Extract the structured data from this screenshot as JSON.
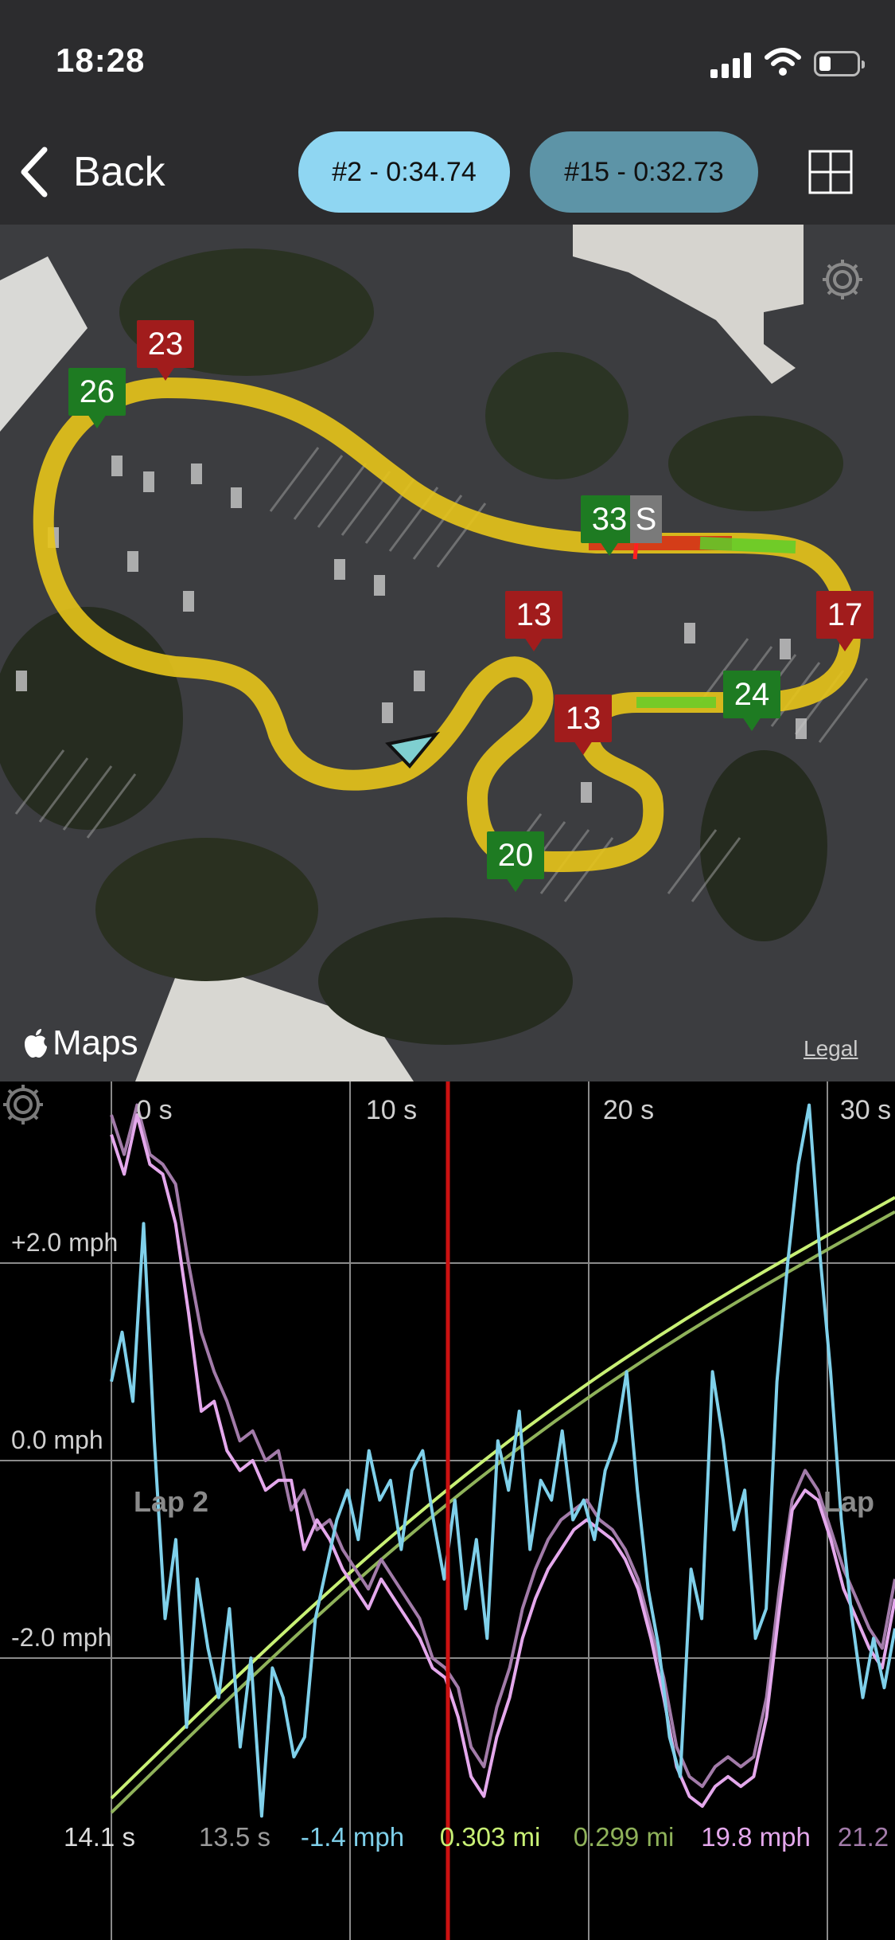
{
  "status_bar": {
    "time": "18:28"
  },
  "nav": {
    "back_label": "Back",
    "lap_a_label": "#2 - 0:34.74",
    "lap_b_label": "#15 - 0:32.73",
    "grid_icon": "grid-icon"
  },
  "map": {
    "attribution": "Maps",
    "legal": "Legal",
    "start_label": "S",
    "markers": [
      {
        "text": "23",
        "color": "red"
      },
      {
        "text": "26",
        "color": "green"
      },
      {
        "text": "33",
        "color": "green"
      },
      {
        "text": "13",
        "color": "red"
      },
      {
        "text": "17",
        "color": "red"
      },
      {
        "text": "24",
        "color": "green"
      },
      {
        "text": "13",
        "color": "red"
      },
      {
        "text": "20",
        "color": "green"
      }
    ]
  },
  "chart_data": {
    "type": "line",
    "x_ticks": [
      "0 s",
      "10 s",
      "20 s",
      "30 s"
    ],
    "y_ticks": [
      "+2.0 mph",
      "0.0 mph",
      "-2.0 mph"
    ],
    "lap_labels": [
      "Lap 2",
      "Lap"
    ],
    "cursor_time_s": 14.1,
    "colors": {
      "delta_speed": "#7fd0ea",
      "speed_a": "#e4a8ec",
      "speed_b": "#a27ba9",
      "distance_a": "#c8f075",
      "distance_b": "#8fb25a",
      "cursor": "#cc1111"
    },
    "readouts": [
      {
        "text": "14.1 s",
        "color": "#dddddd"
      },
      {
        "text": "13.5 s",
        "color": "#9a9a9a"
      },
      {
        "text": "-1.4 mph",
        "color": "#7fd0ea"
      },
      {
        "text": "0.303 mi",
        "color": "#c8f075"
      },
      {
        "text": "0.299 mi",
        "color": "#8fb25a"
      },
      {
        "text": "19.8 mph",
        "color": "#e4a8ec"
      },
      {
        "text": "21.2",
        "color": "#a27ba9"
      }
    ],
    "delta_speed_mph": [
      0.8,
      1.3,
      0.6,
      2.4,
      0.2,
      -1.6,
      -0.8,
      -2.7,
      -1.2,
      -1.9,
      -2.4,
      -1.5,
      -2.9,
      -2.0,
      -3.6,
      -2.1,
      -2.4,
      -3.0,
      -2.8,
      -1.6,
      -1.1,
      -0.6,
      -0.3,
      -0.8,
      0.1,
      -0.4,
      -0.2,
      -0.9,
      -0.1,
      0.1,
      -0.6,
      -1.2,
      -0.4,
      -1.5,
      -0.8,
      -1.8,
      0.2,
      -0.3,
      0.5,
      -0.9,
      -0.2,
      -0.4,
      0.3,
      -0.6,
      -0.4,
      -0.8,
      -0.1,
      0.2,
      0.9,
      -0.3,
      -1.3,
      -1.9,
      -2.8,
      -3.2,
      -1.1,
      -1.6,
      0.9,
      0.2,
      -0.7,
      -0.3,
      -1.8,
      -1.5,
      0.8,
      2.0,
      3.0,
      3.6,
      2.1,
      0.9,
      -0.6,
      -1.6,
      -2.4,
      -1.8,
      -2.3,
      -1.7
    ],
    "speed_a_mph": [
      3.3,
      2.9,
      3.5,
      3.0,
      2.9,
      2.4,
      1.5,
      0.5,
      0.6,
      0.1,
      -0.1,
      0.0,
      -0.3,
      -0.2,
      -0.2,
      -0.9,
      -0.6,
      -0.8,
      -1.1,
      -1.3,
      -1.5,
      -1.2,
      -1.4,
      -1.6,
      -1.8,
      -2.1,
      -2.2,
      -2.6,
      -3.2,
      -3.4,
      -2.8,
      -2.4,
      -1.8,
      -1.4,
      -1.1,
      -0.9,
      -0.7,
      -0.6,
      -0.7,
      -0.8,
      -1.0,
      -1.3,
      -1.8,
      -2.4,
      -3.1,
      -3.4,
      -3.5,
      -3.3,
      -3.2,
      -3.3,
      -3.2,
      -2.6,
      -1.5,
      -0.5,
      -0.3,
      -0.4,
      -0.8,
      -1.3,
      -1.6,
      -1.9,
      -2.1,
      -1.4
    ],
    "speed_b_mph": [
      3.5,
      3.1,
      3.6,
      3.1,
      3.0,
      2.8,
      2.0,
      1.3,
      0.9,
      0.6,
      0.2,
      0.3,
      0.0,
      0.1,
      -0.5,
      -0.3,
      -0.7,
      -0.6,
      -0.9,
      -1.1,
      -1.3,
      -1.0,
      -1.2,
      -1.4,
      -1.6,
      -2.0,
      -2.1,
      -2.3,
      -2.9,
      -3.1,
      -2.5,
      -2.1,
      -1.5,
      -1.1,
      -0.8,
      -0.6,
      -0.5,
      -0.4,
      -0.6,
      -0.7,
      -0.9,
      -1.2,
      -1.7,
      -2.2,
      -2.9,
      -3.2,
      -3.3,
      -3.1,
      -3.0,
      -3.1,
      -3.0,
      -2.4,
      -1.3,
      -0.4,
      -0.1,
      -0.3,
      -0.7,
      -1.1,
      -1.4,
      -1.7,
      -1.9,
      -1.2
    ]
  }
}
